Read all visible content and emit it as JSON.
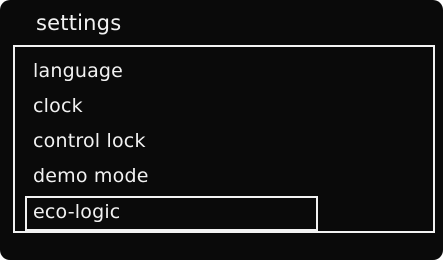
{
  "header": {
    "title": "settings"
  },
  "menu": {
    "items": [
      {
        "label": "language"
      },
      {
        "label": "clock"
      },
      {
        "label": "control lock"
      },
      {
        "label": "demo mode"
      },
      {
        "label": "eco-logic",
        "selected": true
      }
    ]
  },
  "colors": {
    "background": "#0a0a0a",
    "foreground": "#f2f2f2"
  }
}
